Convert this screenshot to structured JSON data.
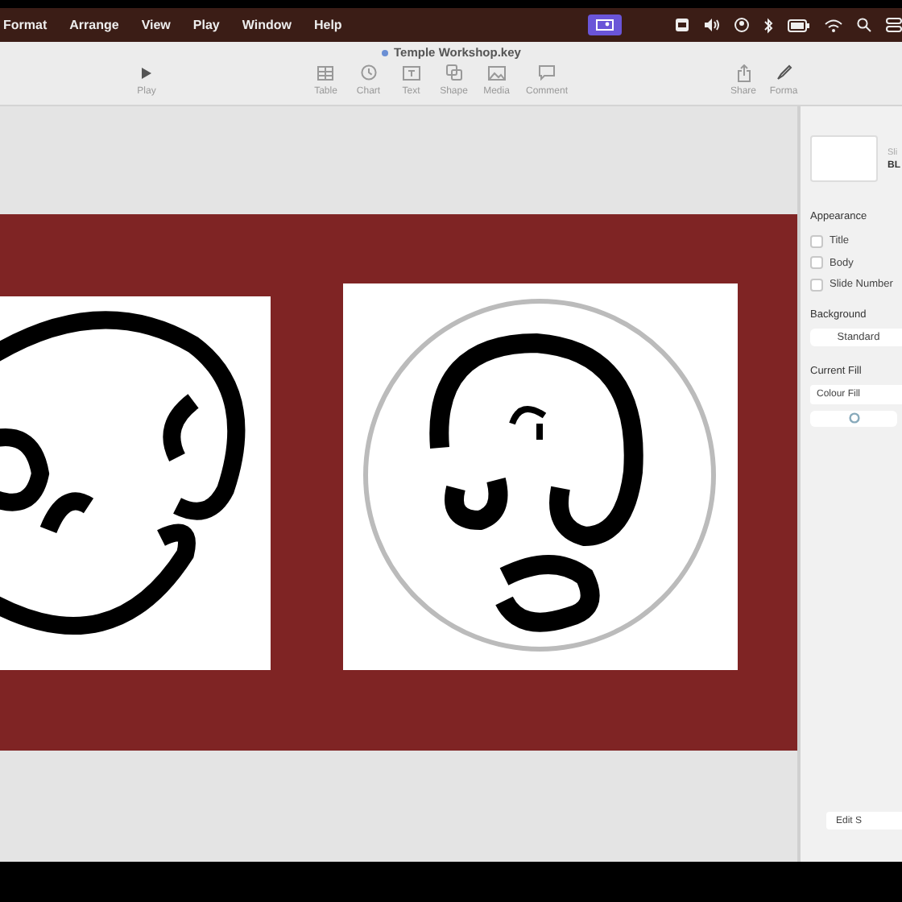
{
  "menu_bar": {
    "items": [
      "Format",
      "Arrange",
      "View",
      "Play",
      "Window",
      "Help"
    ]
  },
  "window": {
    "title": "Temple Workshop.key"
  },
  "toolbar": {
    "left": [
      {
        "label": "Play",
        "kind": "play"
      }
    ],
    "center": [
      {
        "label": "Table",
        "kind": "table"
      },
      {
        "label": "Chart",
        "kind": "chart"
      },
      {
        "label": "Text",
        "kind": "text"
      },
      {
        "label": "Shape",
        "kind": "shape"
      },
      {
        "label": "Media",
        "kind": "media"
      },
      {
        "label": "Comment",
        "kind": "comment"
      }
    ],
    "right": [
      {
        "label": "Share",
        "kind": "share"
      },
      {
        "label": "Forma",
        "kind": "format"
      }
    ]
  },
  "inspector": {
    "layout_label": "Sli",
    "layout_name": "BL",
    "appearance": {
      "heading": "Appearance",
      "options": [
        {
          "label": "Title",
          "checked": false
        },
        {
          "label": "Body",
          "checked": false
        },
        {
          "label": "Slide Number",
          "checked": false
        }
      ]
    },
    "background": {
      "heading": "Background",
      "value": "Standard"
    },
    "current_fill": {
      "heading": "Current Fill",
      "value": "Colour Fill"
    },
    "edit_button": "Edit S"
  }
}
